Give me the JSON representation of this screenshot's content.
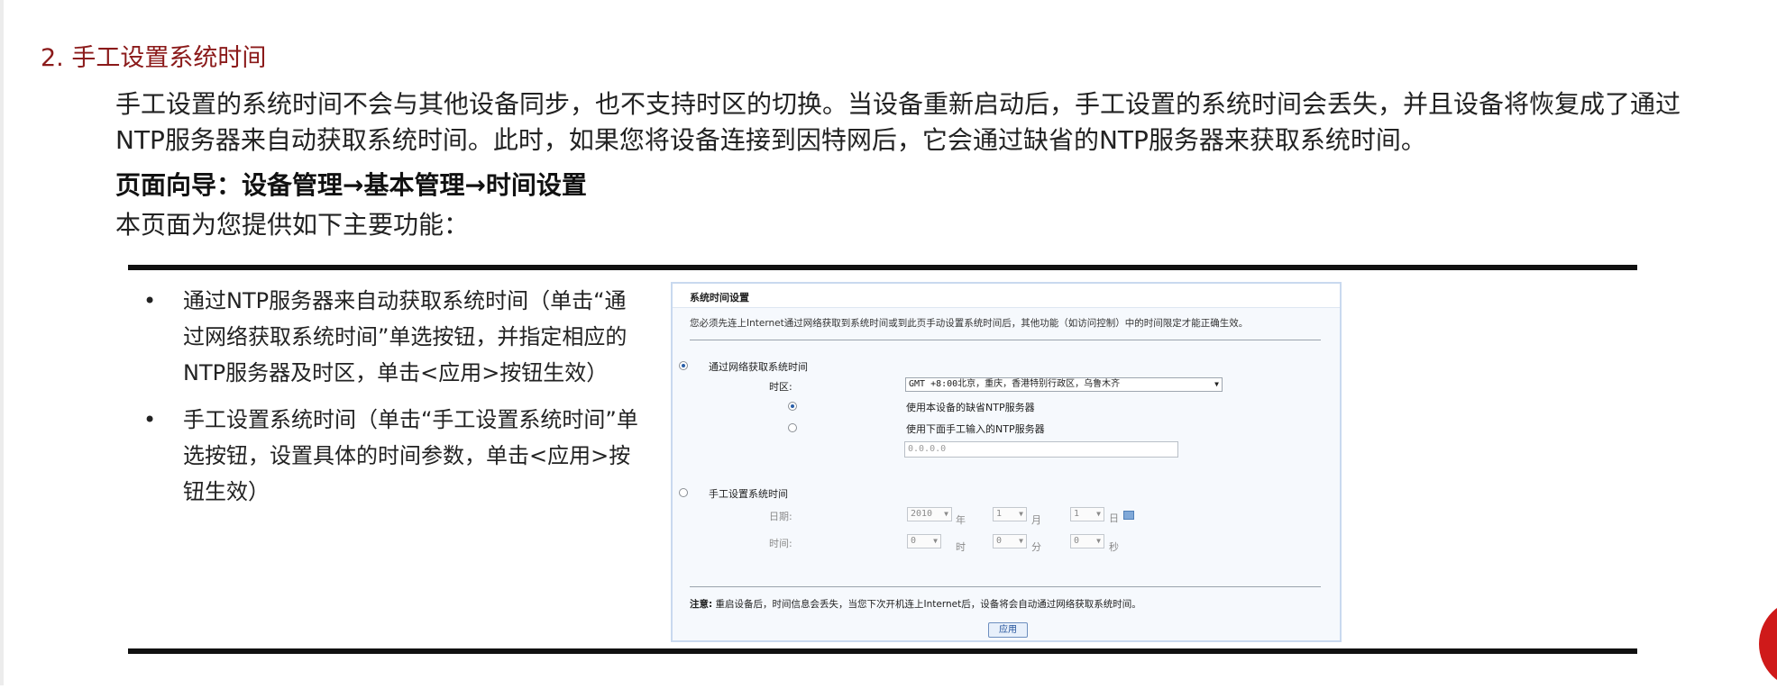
{
  "doc": {
    "section_title": "2. 手工设置系统时间",
    "paragraph": "手工设置的系统时间不会与其他设备同步，也不支持时区的切换。当设备重新启动后，手工设置的系统时间会丢失，并且设备将恢复成了通过NTP服务器来自动获取系统时间。此时，如果您将设备连接到因特网后，它会通过缺省的NTP服务器来获取系统时间。",
    "nav": "页面向导：设备管理→基本管理→时间设置",
    "intro": "本页面为您提供如下主要功能：",
    "bullets": [
      "通过NTP服务器来自动获取系统时间（单击“通过网络获取系统时间”单选按钮，并指定相应的NTP服务器及时区，单击<应用>按钮生效）",
      "手工设置系统时间（单击“手工设置系统时间”单选按钮，设置具体的时间参数，单击<应用>按钮生效）"
    ],
    "bullet_symbol": "•"
  },
  "panel": {
    "title": "系统时间设置",
    "notice": "您必须先连上Internet通过网络获取到系统时间或到此页手动设置系统时间后，其他功能（如访问控制）中的时间限定才能正确生效。",
    "net_radio_label": "通过网络获取系统时间",
    "tz_label": "时区:",
    "tz_value": "GMT +8:00北京，重庆，香港特别行政区，乌鲁木齐",
    "default_ntp_label": "使用本设备的缺省NTP服务器",
    "manual_ntp_label": "使用下面手工输入的NTP服务器",
    "ntp_placeholder": "0.0.0.0",
    "manual_radio_label": "手工设置系统时间",
    "date_label": "日期:",
    "year_value": "2010",
    "year_unit": "年",
    "month_value": "1",
    "month_unit": "月",
    "day_value": "1",
    "day_unit": "日",
    "time_label": "时间:",
    "hour_value": "0",
    "hour_unit": "时",
    "minute_value": "0",
    "minute_unit": "分",
    "second_value": "0",
    "second_unit": "秒",
    "note_bold": "注意:",
    "note_text": "重启设备后，时间信息会丢失，当您下次开机连上Internet后，设备将会自动通过网络获取系统时间。",
    "apply_label": "应用",
    "dropdown_arrow": "▼"
  },
  "colors": {
    "section_title": "#8b1a1a",
    "rule": "#111111",
    "panel_border": "#c9d9ef",
    "radio_selected": "#2a5fa8"
  },
  "icons": [
    "bullet-dot-icon",
    "calendar-icon",
    "dropdown-arrow-icon"
  ]
}
